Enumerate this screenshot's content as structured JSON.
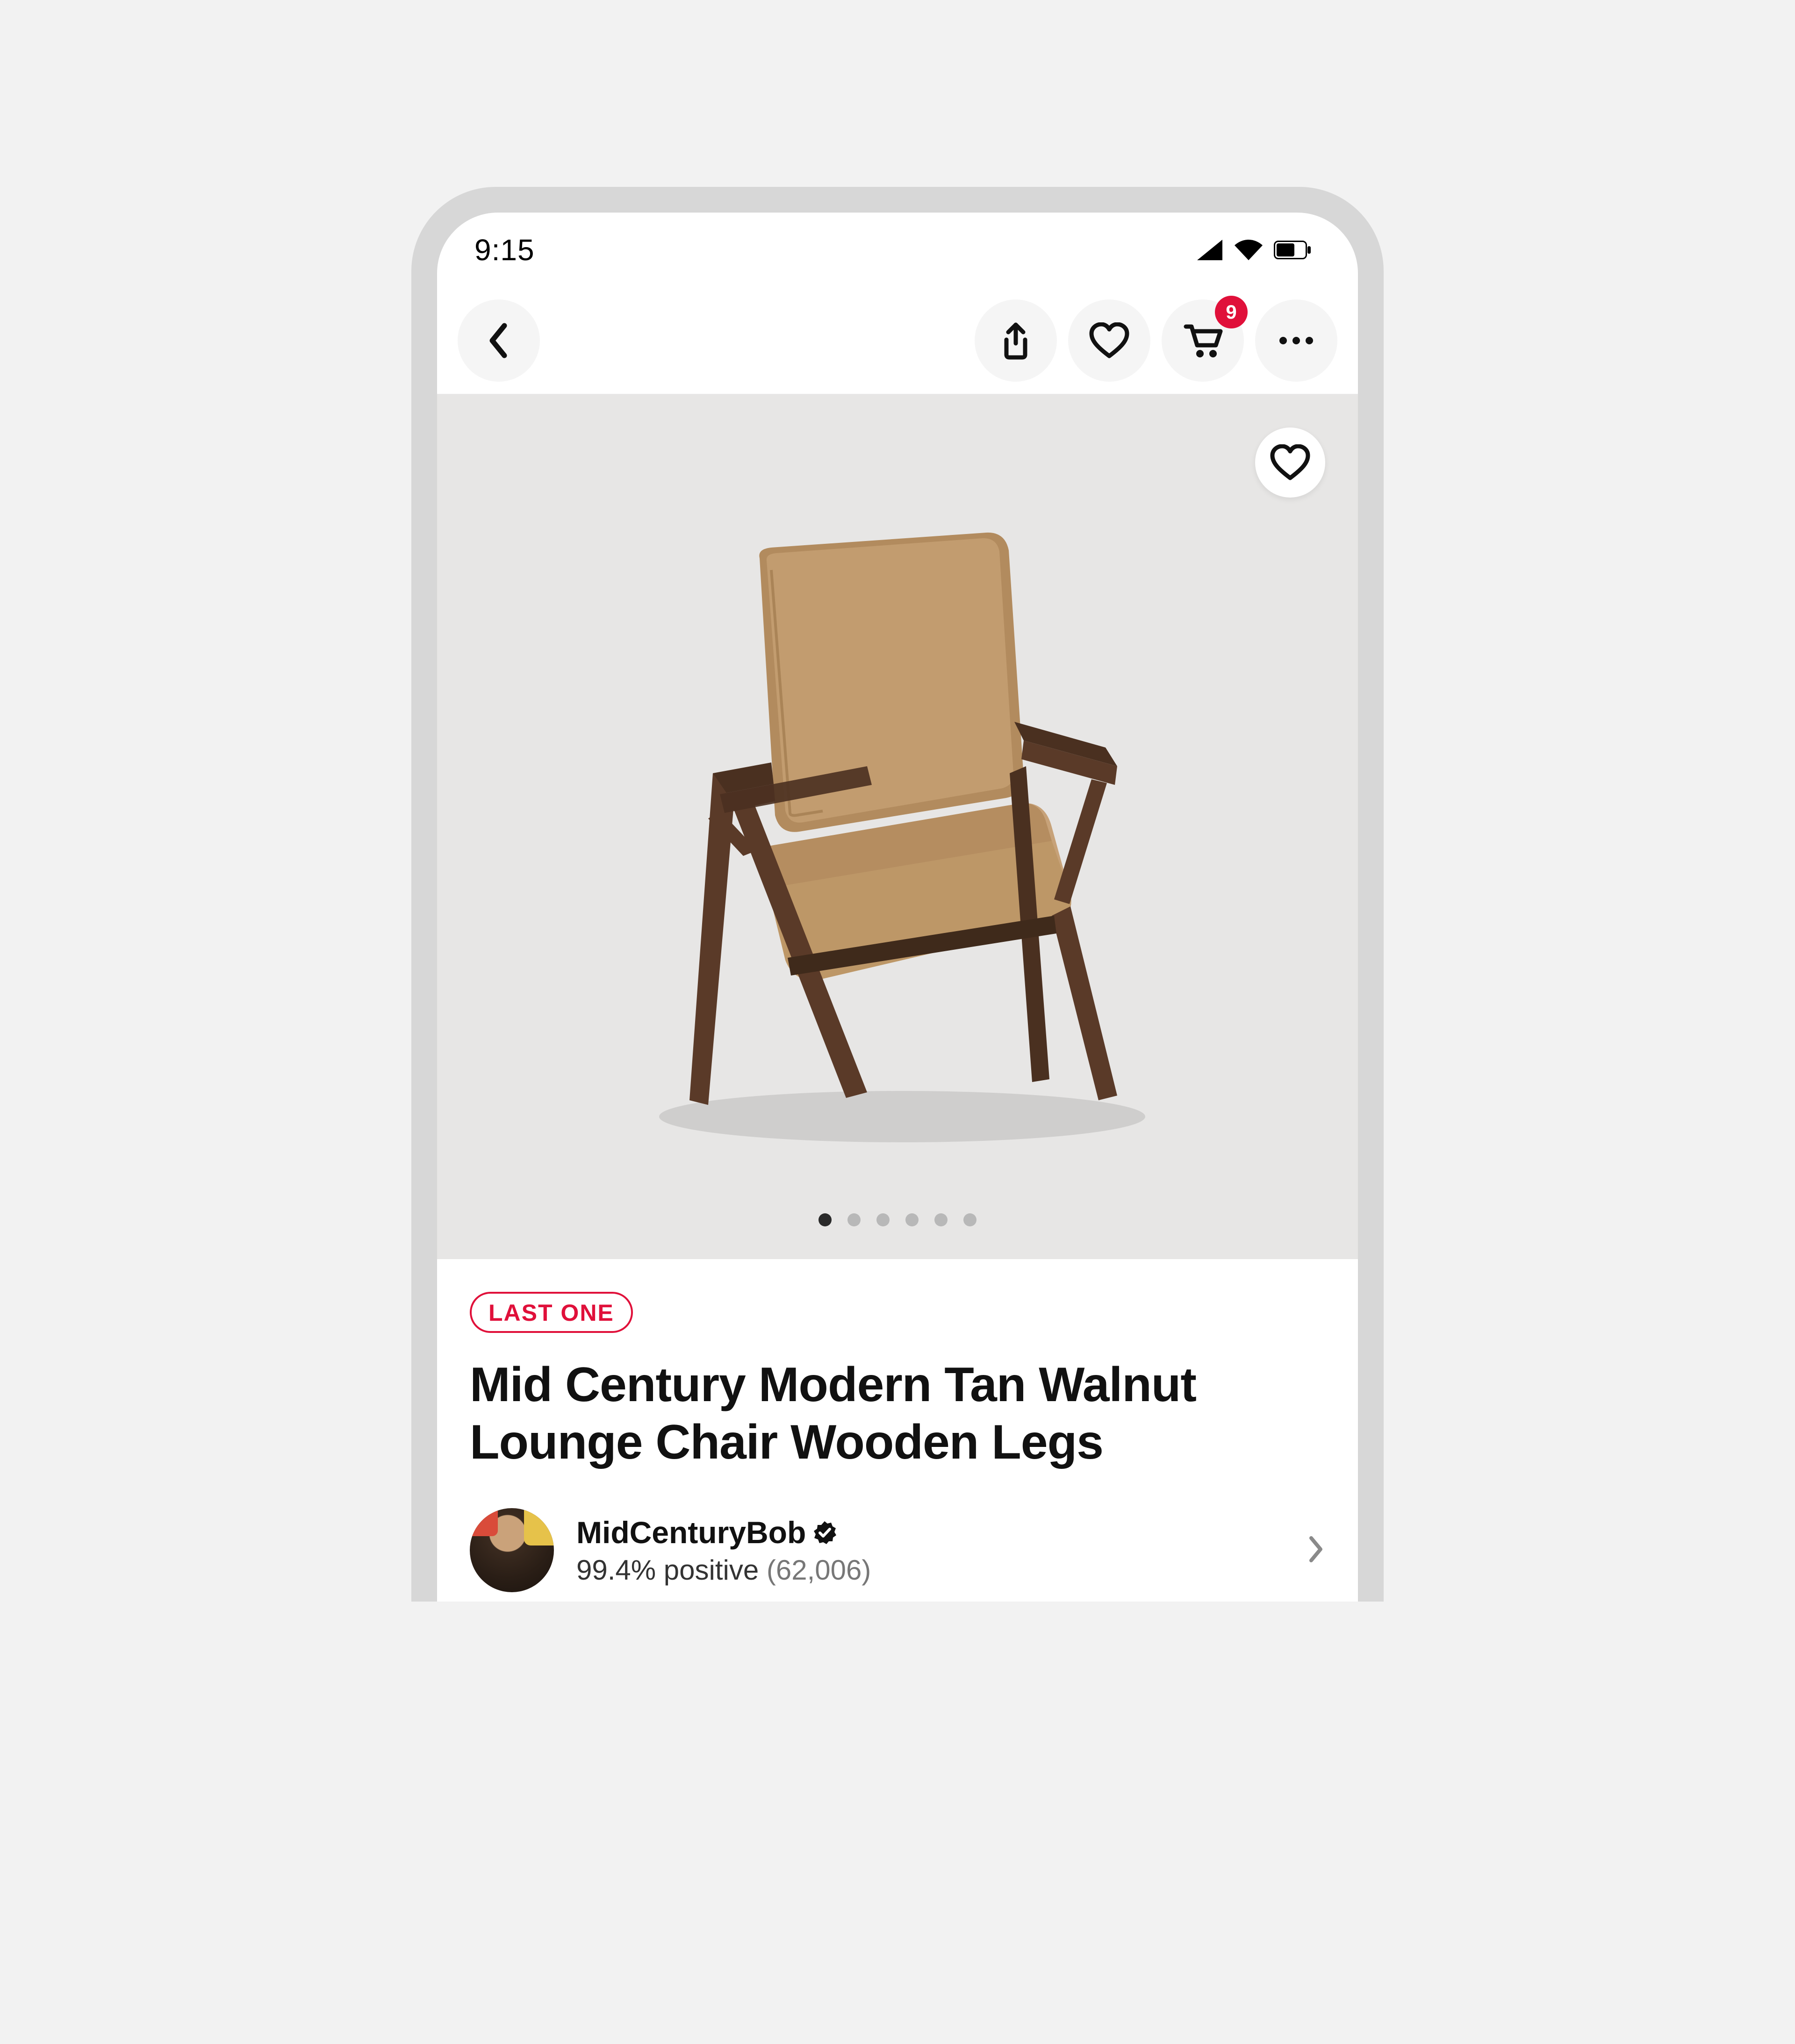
{
  "status": {
    "time": "9:15"
  },
  "nav": {
    "cart_badge": "9"
  },
  "hero": {
    "image_alt": "Tan leather mid-century lounge chair with walnut wooden legs",
    "page_dot_count": 6,
    "page_dot_active_index": 0
  },
  "product": {
    "stock_pill": "LAST ONE",
    "title": "Mid Century Modern Tan Walnut Lounge Chair Wooden Legs"
  },
  "seller": {
    "name": "MidCenturyBob",
    "positive_pct": "99.4% positive",
    "review_count": "(62,006)"
  },
  "colors": {
    "accent_red": "#e0103a"
  }
}
